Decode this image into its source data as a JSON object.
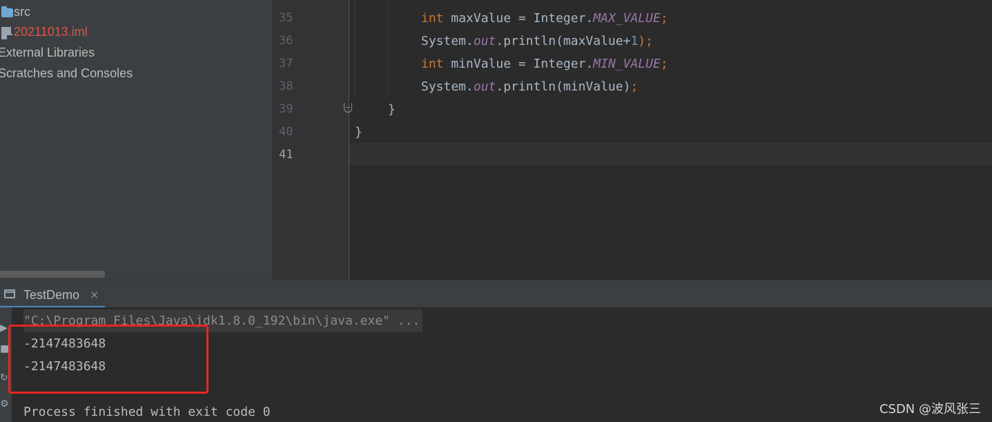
{
  "project_tree": {
    "items": [
      {
        "label": "src",
        "icon": "folder-icon"
      },
      {
        "label": "20211013.iml",
        "icon": "module-file-icon"
      },
      {
        "label": "External Libraries"
      },
      {
        "label": "Scratches and Consoles"
      }
    ]
  },
  "editor": {
    "line_numbers": [
      "35",
      "36",
      "37",
      "38",
      "39",
      "40",
      "41"
    ],
    "current_line": "41",
    "lines": [
      {
        "t1": "int",
        "t2": " maxValue = Integer.",
        "t3": "MAX_VALUE",
        "t4": ";"
      },
      {
        "t1": "System.",
        "t2": "out",
        "t3": ".println(maxValue+",
        "t4": "1",
        "t5": ");"
      },
      {
        "t1": "int",
        "t2": " minValue = Integer.",
        "t3": "MIN_VALUE",
        "t4": ";"
      },
      {
        "t1": "System.",
        "t2": "out",
        "t3": ".println(minValue)",
        "t4": ";"
      },
      {
        "t1": "}"
      },
      {
        "t1": "}"
      }
    ]
  },
  "run_window": {
    "tab_label": "TestDemo",
    "close_glyph": "×",
    "command_line": "\"C:\\Program Files\\Java\\jdk1.8.0_192\\bin\\java.exe\" ...",
    "output": [
      "-2147483648",
      "-2147483648"
    ],
    "exit_message": "Process finished with exit code 0"
  },
  "watermark": "CSDN @波风张三",
  "colors": {
    "keyword": "#cc7832",
    "constant": "#9876aa",
    "number": "#6897bb",
    "highlight_box": "#e8261e",
    "error_file": "#d9574a"
  }
}
